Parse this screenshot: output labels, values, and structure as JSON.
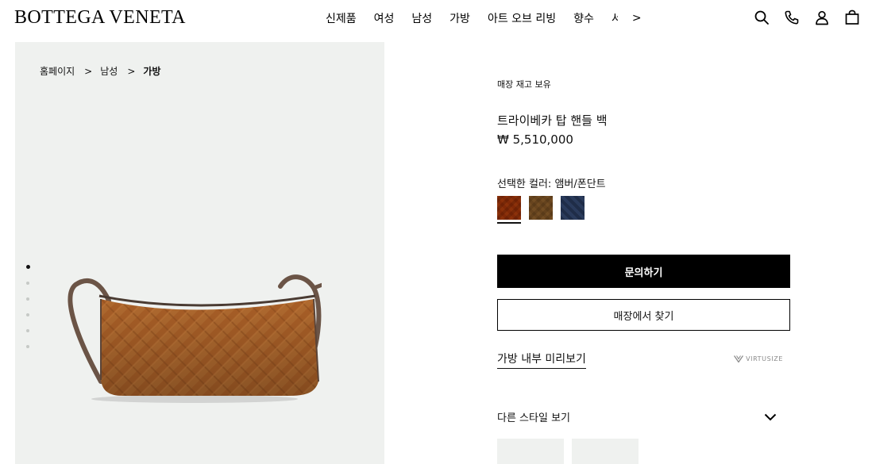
{
  "brand": {
    "logo": "BOTTEGA VENETA"
  },
  "nav": {
    "items": [
      "신제품",
      "여성",
      "남성",
      "가방",
      "아트 오브 리빙",
      "향수"
    ],
    "clipped_item": "서",
    "next_arrow": ">"
  },
  "header_icons": [
    "search-icon",
    "phone-icon",
    "account-icon",
    "shopping-bag-icon"
  ],
  "breadcrumb": {
    "items": [
      "홈페이지",
      "남성",
      "가방"
    ],
    "separator": ">"
  },
  "gallery": {
    "image_count": 6,
    "active_index": 0
  },
  "product": {
    "stock_status": "매장 재고 보유",
    "title": "트라이베카 탑 핸들 백",
    "price": "₩ 5,510,000",
    "selected_color_label": "선택한 컬러: 앰버/폰단트",
    "colors": [
      {
        "name": "amber",
        "hex": "#b5662a",
        "selected": true
      },
      {
        "name": "tan",
        "hex": "#a28458",
        "selected": false
      },
      {
        "name": "navy",
        "hex": "#1f2d48",
        "selected": false
      }
    ],
    "primary_button": "문의하기",
    "secondary_button": "매장에서 찾기",
    "preview_link": "가방 내부 미리보기",
    "virtusize_label": "VIRTUSIZE",
    "other_styles_label": "다른 스타일 보기"
  },
  "colors": {
    "panel_bg": "#eff1ef",
    "primary_button_bg": "#000000",
    "bag_leather": "#b06a2f",
    "bag_strap": "#6b5446"
  }
}
